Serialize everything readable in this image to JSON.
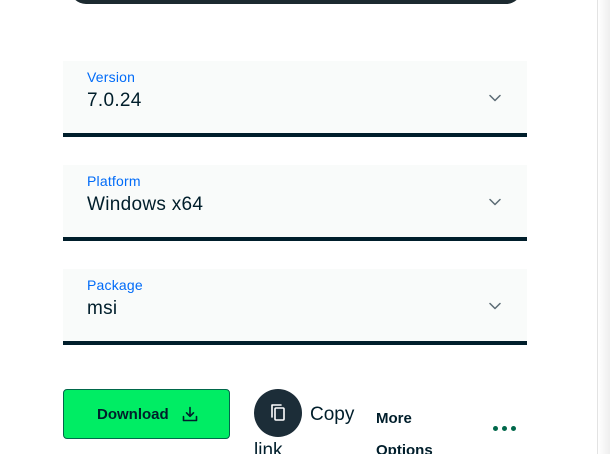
{
  "fields": [
    {
      "label": "Version",
      "value": "7.0.24"
    },
    {
      "label": "Platform",
      "value": "Windows x64"
    },
    {
      "label": "Package",
      "value": "msi"
    }
  ],
  "actions": {
    "download_label": "Download",
    "copy_link_line1": "Copy",
    "copy_link_line2": "link",
    "more_options_line1": "More",
    "more_options_line2": "Options"
  },
  "icons": {
    "chevron": "chevron-down-icon",
    "download": "download-icon",
    "copy": "copy-icon",
    "ellipsis": "ellipsis-icon"
  },
  "colors": {
    "accent_green": "#00ed64",
    "dark_green": "#00684a",
    "label_blue": "#016bf8",
    "text_dark": "#001e2b",
    "field_bg": "#f9fbfa"
  }
}
